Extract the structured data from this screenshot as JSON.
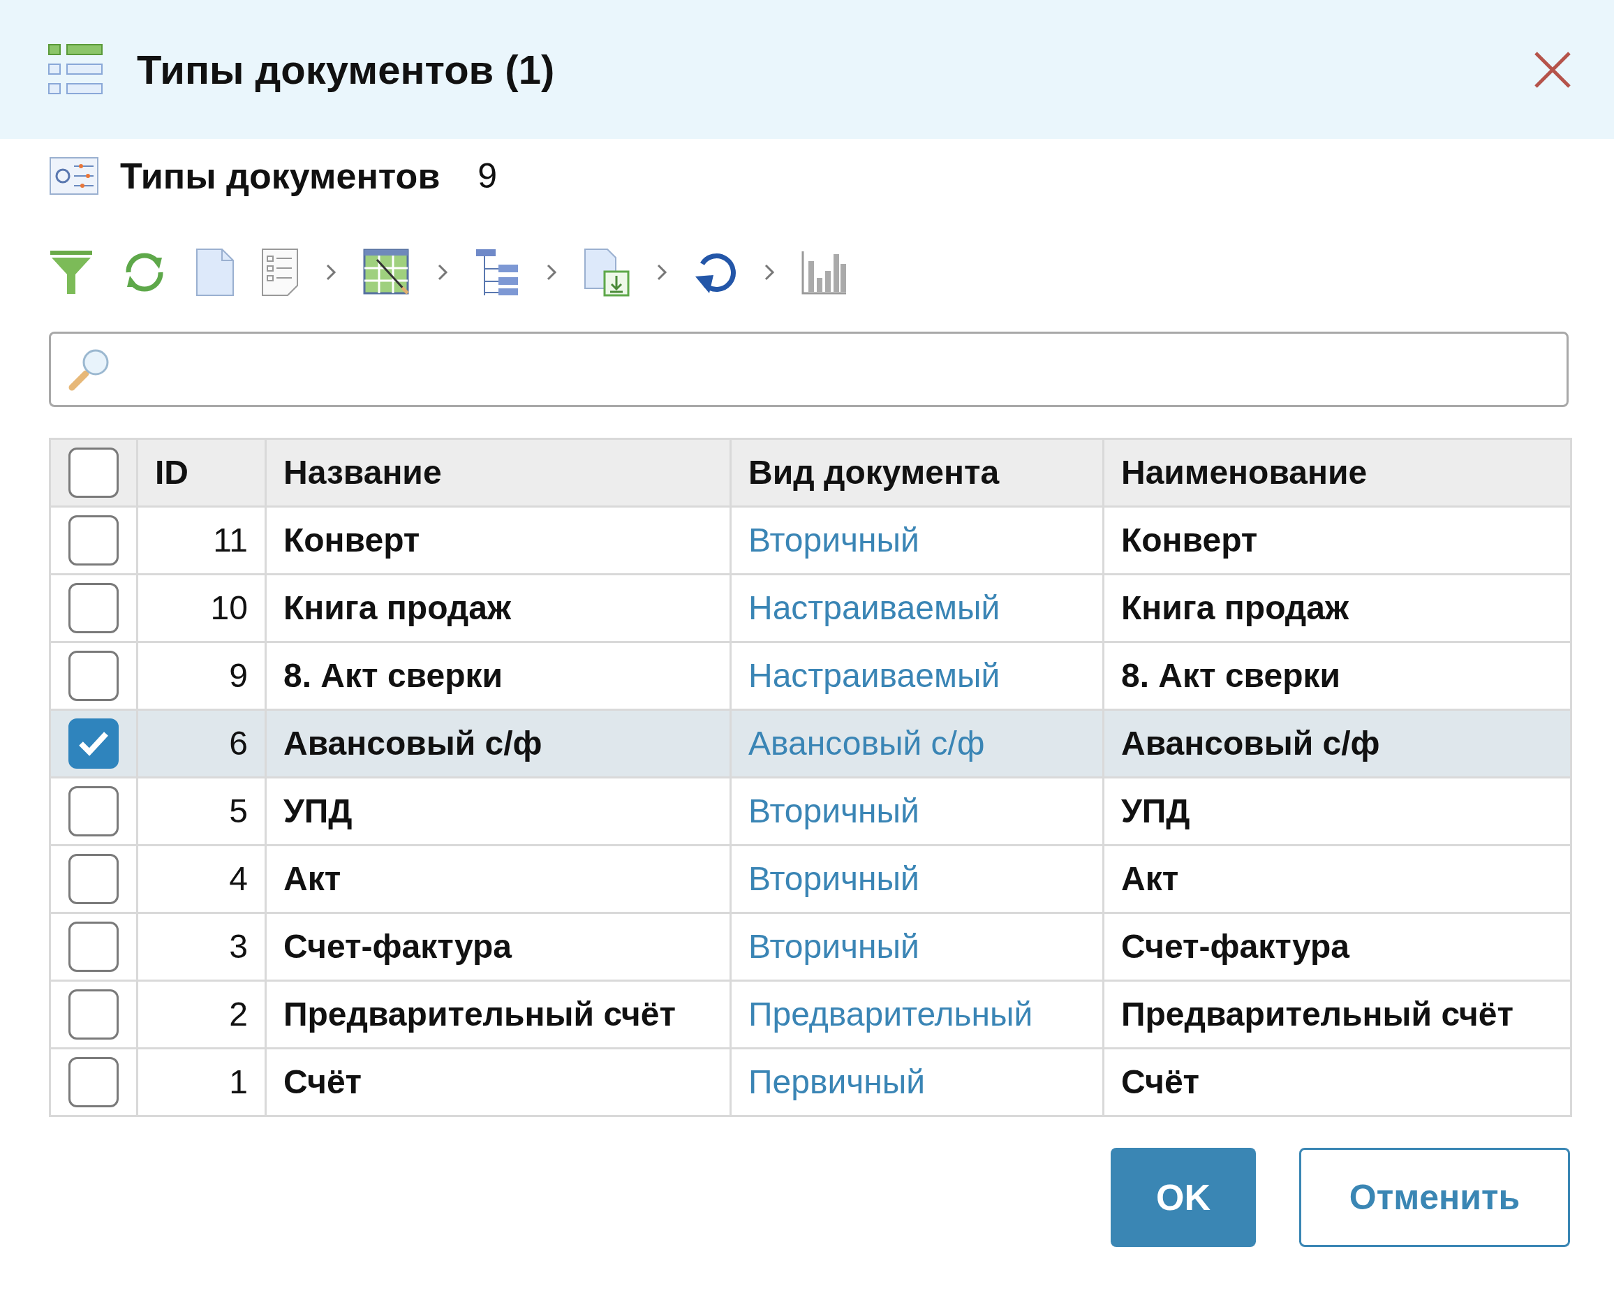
{
  "dialog": {
    "title": "Типы документов (1)"
  },
  "list_header": {
    "title": "Типы документов",
    "count": "9"
  },
  "table": {
    "columns": [
      "ID",
      "Название",
      "Вид документа",
      "Наименование"
    ],
    "header_checkbox": {
      "checked": false
    },
    "rows": [
      {
        "id": "11",
        "name": "Конверт",
        "document_kind": "Вторичный",
        "full_name": "Конверт",
        "selected": false
      },
      {
        "id": "10",
        "name": "Книга продаж",
        "document_kind": "Настраиваемый",
        "full_name": "Книга продаж",
        "selected": false
      },
      {
        "id": "9",
        "name": "8. Акт сверки",
        "document_kind": "Настраиваемый",
        "full_name": "8. Акт сверки",
        "selected": false
      },
      {
        "id": "6",
        "name": "Авансовый с/ф",
        "document_kind": "Авансовый с/ф",
        "full_name": "Авансовый с/ф",
        "selected": true
      },
      {
        "id": "5",
        "name": "УПД",
        "document_kind": "Вторичный",
        "full_name": "УПД",
        "selected": false
      },
      {
        "id": "4",
        "name": "Акт",
        "document_kind": "Вторичный",
        "full_name": "Акт",
        "selected": false
      },
      {
        "id": "3",
        "name": "Счет-фактура",
        "document_kind": "Вторичный",
        "full_name": "Счет-фактура",
        "selected": false
      },
      {
        "id": "2",
        "name": "Предварительный счёт",
        "document_kind": "Предварительный",
        "full_name": "Предварительный счёт",
        "selected": false
      },
      {
        "id": "1",
        "name": "Счёт",
        "document_kind": "Первичный",
        "full_name": "Счёт",
        "selected": false
      }
    ]
  },
  "buttons": [
    {
      "label": "OK",
      "kind": "primary"
    },
    {
      "label": "Отменить",
      "kind": "secondary"
    }
  ]
}
